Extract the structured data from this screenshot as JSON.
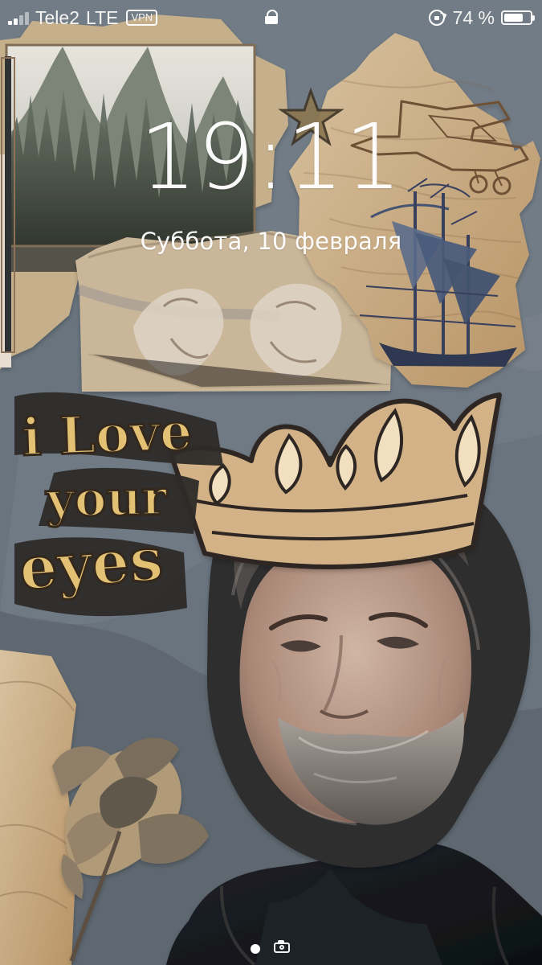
{
  "status": {
    "carrier": "Tele2",
    "network": "LTE",
    "vpn_label": "VPN",
    "battery": 74,
    "battery_text": "74 %"
  },
  "lockscreen": {
    "time": "19:11",
    "date": "Суббота, 10 февраля"
  },
  "wallpaper": {
    "lettering_lines": [
      "i Love",
      "your",
      "eyes"
    ]
  },
  "icons": {
    "lock": "lock-icon",
    "rotation_lock": "rotation-lock-icon",
    "battery": "battery-icon",
    "camera": "camera-icon"
  },
  "colors": {
    "text": "#ffffff",
    "paper": "#bf9f78",
    "blue_ink": "#3f4d6a"
  }
}
